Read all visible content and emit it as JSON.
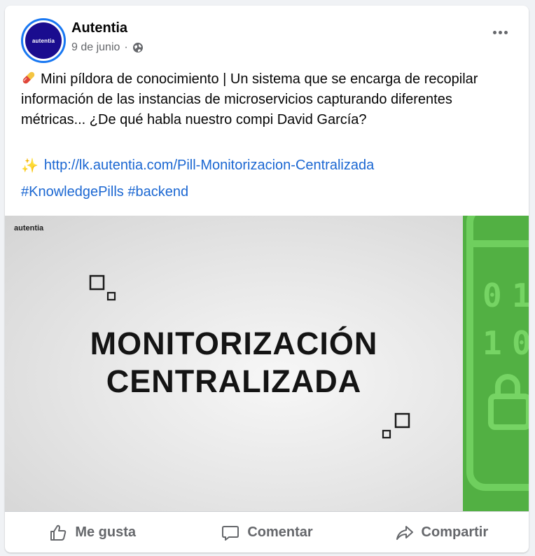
{
  "post": {
    "page_name": "Autentia",
    "avatar_text": "autentia",
    "date": "9 de junio",
    "date_separator": "·",
    "text": "Mini píldora de conocimiento | Un sistema que se encarga de recopilar información de las instancias de microservicios capturando diferentes métricas... ¿De qué habla nuestro compi David García?",
    "link": "http://lk.autentia.com/Pill-Monitorizacion-Centralizada",
    "hashtags": [
      "#KnowledgePills",
      "#backend"
    ]
  },
  "media": {
    "brand": "autentia",
    "title_line1": "MONITORIZACIÓN",
    "title_line2": "CENTRALIZADA",
    "green_chars": [
      "0",
      "1",
      "1",
      "0"
    ]
  },
  "actions": {
    "like": "Me gusta",
    "comment": "Comentar",
    "share": "Compartir"
  },
  "colors": {
    "link": "#1b67d2",
    "avatar_bg": "#1a0c8f",
    "accent_ring": "#1877f2",
    "media_green": "#52b043"
  },
  "icons": [
    "pill-icon",
    "sparkles-icon",
    "globe-icon",
    "more-icon",
    "like-icon",
    "comment-icon",
    "share-icon"
  ]
}
